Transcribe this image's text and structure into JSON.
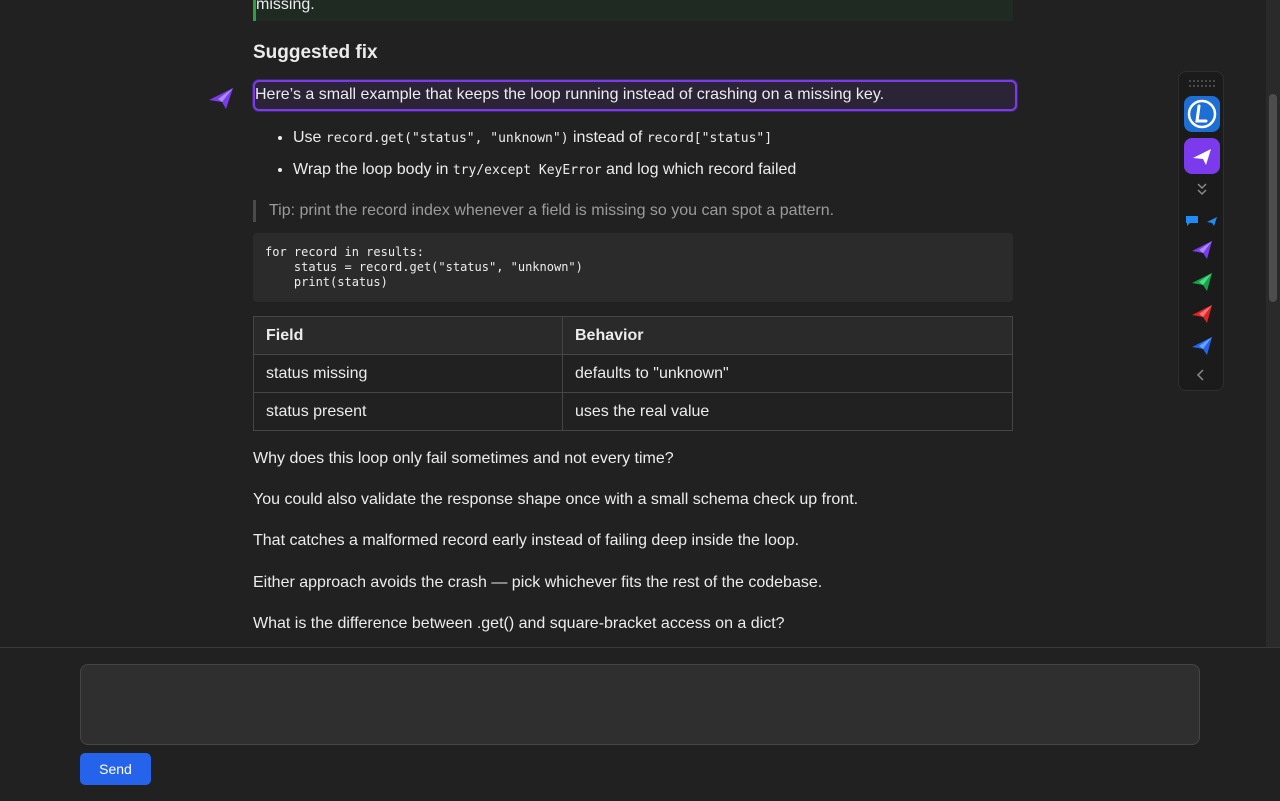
{
  "message": {
    "top_quote": "missing.",
    "heading": "Suggested fix",
    "intro": "Here’s a small example that keeps the loop running instead of crashing on a missing key.",
    "bullets": [
      {
        "pre": "Use ",
        "code1": "record.get(\"status\", \"unknown\")",
        "mid": " instead of ",
        "code2": "record[\"status\"]",
        "post": ""
      },
      {
        "pre": "Wrap the loop body in ",
        "code1": "try/except KeyError",
        "mid": " and log which record failed",
        "code2": "",
        "post": ""
      }
    ],
    "tip": "Tip: print the record index whenever a field is missing so you can spot a pattern.",
    "code": "for record in results:\n    status = record.get(\"status\", \"unknown\")\n    print(status)",
    "table": {
      "headers": [
        "Field",
        "Behavior"
      ],
      "rows": [
        [
          "status missing",
          "defaults to \"unknown\""
        ],
        [
          "status present",
          "uses the real value"
        ]
      ]
    },
    "paragraphs": [
      "Why does this loop only fail sometimes and not every time?",
      "You could also validate the response shape once with a small schema check up front.",
      "That catches a malformed record early instead of failing deep inside the loop.",
      "Either approach avoids the crash — pick whichever fits the rest of the codebase.",
      "What is the difference between .get() and square-bracket access on a dict?"
    ]
  },
  "composer": {
    "value": "",
    "placeholder": "",
    "send_label": "Send"
  },
  "side_panel": {
    "icons": [
      "drag-handle-icon",
      "extension-logo-icon",
      "assistant-icon",
      "collapse-icon",
      "chat-bubble-icon",
      "assistant-small-icon",
      "assistant-purple-icon",
      "assistant-green-icon",
      "assistant-red-icon",
      "assistant-blue-icon",
      "chevron-left-icon"
    ]
  },
  "colors": {
    "background": "#212121",
    "accent_purple": "#7c3aed",
    "send_blue": "#2563eb",
    "quote_green": "#2ea043"
  }
}
